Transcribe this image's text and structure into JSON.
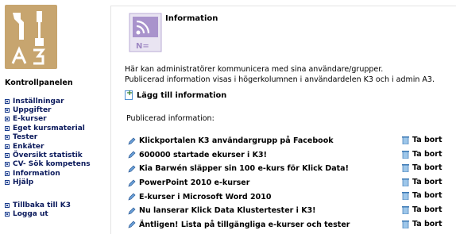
{
  "logo": {
    "name": "a3-logo",
    "text": "A3"
  },
  "sidebar": {
    "title": "Kontrollpanelen",
    "items": [
      {
        "label": "Inställningar"
      },
      {
        "label": "Uppgifter"
      },
      {
        "label": "E-kurser"
      },
      {
        "label": "Eget kursmaterial"
      },
      {
        "label": "Tester"
      },
      {
        "label": "Enkäter"
      },
      {
        "label": "Översikt statistik"
      },
      {
        "label": "CV- Sök kompetens"
      },
      {
        "label": "Information"
      },
      {
        "label": "Hjälp"
      }
    ],
    "bottom_items": [
      {
        "label": "Tillbaka till K3"
      },
      {
        "label": "Logga ut"
      }
    ]
  },
  "main": {
    "title": "Information",
    "intro_line1": "Här kan administratörer kommunicera med sina användare/grupper.",
    "intro_line2": "Publicerad information visas i högerkolumnen i användardelen K3 och i admin A3.",
    "add_label": "Lägg till information",
    "published_label": "Publicerad information:",
    "delete_label": "Ta bort",
    "items": [
      {
        "title": "Klickportalen K3 användargrupp på Facebook"
      },
      {
        "title": "600000 startade ekurser i K3!"
      },
      {
        "title": "Kia Barwén släpper sin 100 e-kurs för Klick Data!"
      },
      {
        "title": "PowerPoint 2010 e-kurser"
      },
      {
        "title": "E-kurser i Microsoft Word 2010"
      },
      {
        "title": "Nu lanserar Klick Data Klustertester i K3!"
      },
      {
        "title": "Äntligen! Lista på tillgängliga e-kurser och tester"
      }
    ]
  },
  "colors": {
    "logo_bg": "#c7a56f",
    "nav_text": "#0b1a5c",
    "info_icon": "#9f89c4"
  }
}
